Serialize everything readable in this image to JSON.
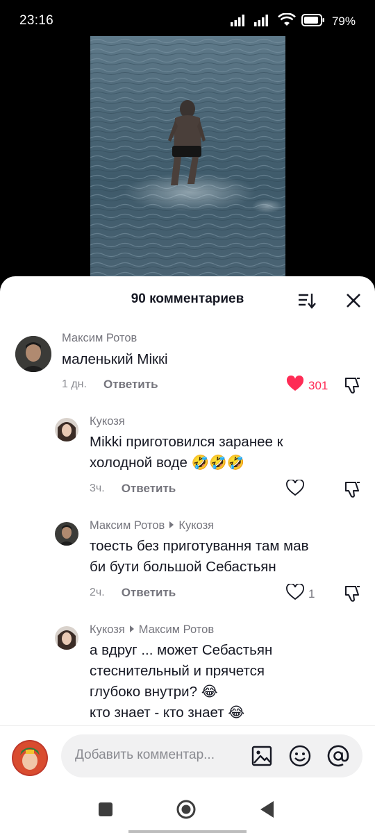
{
  "status_bar": {
    "time": "23:16",
    "battery": "79%"
  },
  "comments_sheet": {
    "title": "90 комментариев",
    "comments": [
      {
        "author": "Максим Ротов",
        "text": "маленький Міккі",
        "age": "1 дн.",
        "reply_label": "Ответить",
        "likes": "301",
        "liked": true
      },
      {
        "author": "Кукозя",
        "text_lines": [
          "Mikki приготовился заранее к",
          "холодной воде 🤣🤣🤣"
        ],
        "age": "3ч.",
        "reply_label": "Ответить",
        "likes": ""
      },
      {
        "author": "Максим Ротов",
        "reply_to": "Кукозя",
        "text_lines": [
          "тоесть без приготування там мав",
          "би бути большой Себастьян"
        ],
        "age": "2ч.",
        "reply_label": "Ответить",
        "likes": "1"
      },
      {
        "author": "Кукозя",
        "reply_to": "Максим Ротов",
        "text_lines": [
          "а вдруг ... может Себастьян",
          "стеснительный и прячется",
          "глубоко внутри? 😂",
          "кто знает - кто знает 😂"
        ]
      }
    ]
  },
  "input_bar": {
    "placeholder": "Добавить комментар..."
  },
  "colors": {
    "like_red": "#fe2c55",
    "text_primary": "#161823",
    "text_secondary": "#75757d"
  },
  "icons": [
    "signal-icon",
    "wifi-icon",
    "battery-icon",
    "sort-icon",
    "close-icon",
    "heart-icon",
    "dislike-icon",
    "image-icon",
    "emoji-icon",
    "mention-icon",
    "recents-icon",
    "home-icon",
    "back-icon"
  ]
}
